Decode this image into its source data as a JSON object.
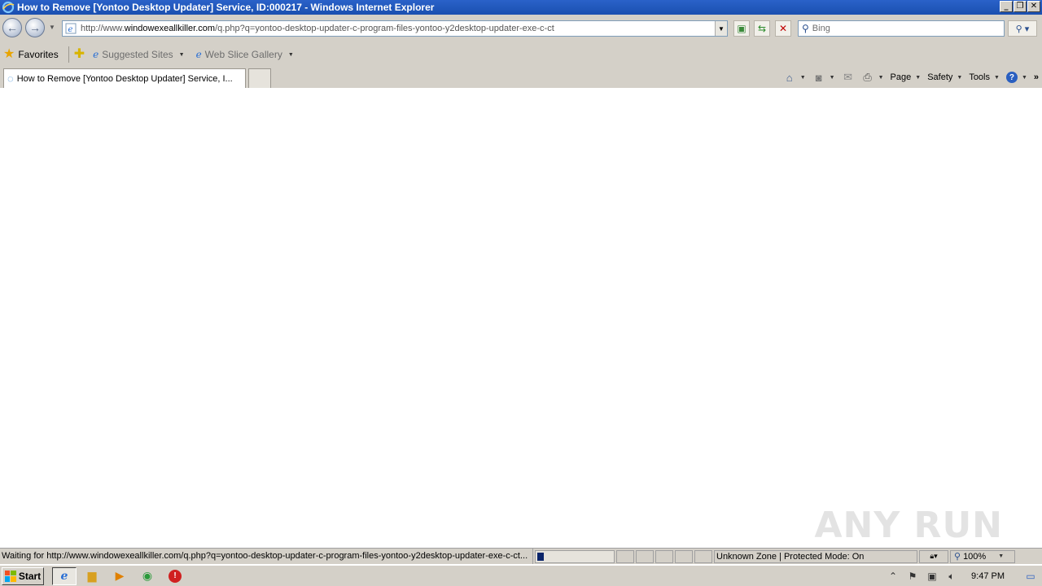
{
  "window": {
    "title": "How to Remove [Yontoo Desktop Updater] Service, ID:000217 - Windows Internet Explorer",
    "buttons": {
      "minimize": "_",
      "restore": "❐",
      "close": "✕"
    }
  },
  "nav": {
    "url_prefix": "http://www.",
    "url_domain": "windowexeallkiller.com",
    "url_path": "/q.php?q=yontoo-desktop-updater-c-program-files-yontoo-y2desktop-updater-exe-c-ct",
    "search_placeholder": "Bing"
  },
  "favorites": {
    "favorites_label": "Favorites",
    "suggested_sites": "Suggested Sites",
    "web_slice_gallery": "Web Slice Gallery"
  },
  "tabs": [
    {
      "label": "How to Remove [Yontoo Desktop Updater] Service, I..."
    }
  ],
  "command_bar": {
    "page": "Page",
    "safety": "Safety",
    "tools": "Tools"
  },
  "status": {
    "text": "Waiting for http://www.windowexeallkiller.com/q.php?q=yontoo-desktop-updater-c-program-files-yontoo-y2desktop-updater-exe-c-ct...",
    "progress": 0.06,
    "zone": "Unknown Zone | Protected Mode: On",
    "zoom": "100%"
  },
  "taskbar": {
    "start_label": "Start",
    "clock": "9:47 PM"
  },
  "watermark": "ANY RUN",
  "colors": {
    "titlebar": "#1a4fb0",
    "chrome": "#d4d0c8",
    "progress_fill": "#0a246a"
  }
}
